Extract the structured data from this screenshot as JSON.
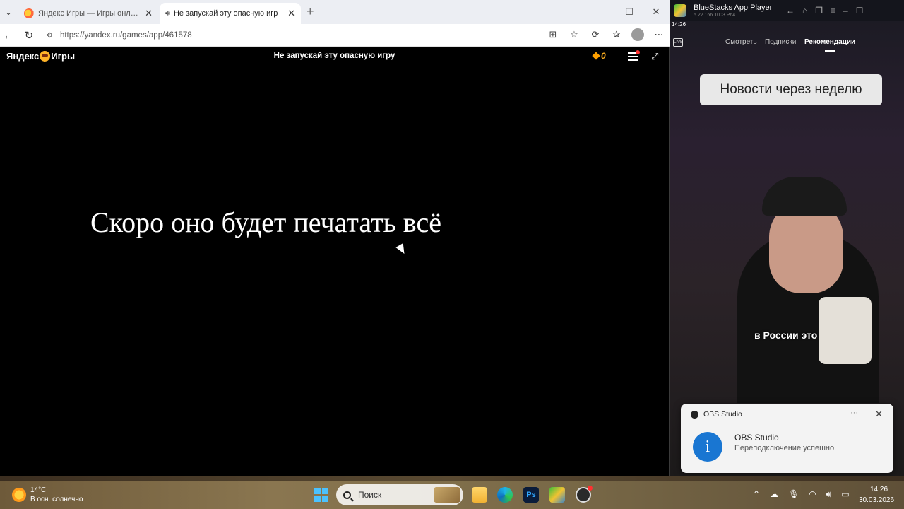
{
  "browser": {
    "tabs": [
      {
        "title": "Яндекс Игры — Игры онлайн бе",
        "active": false
      },
      {
        "title": "Не запускай эту опасную игр",
        "active": true
      }
    ],
    "url": "https://yandex.ru/games/app/461578"
  },
  "game": {
    "logo": "Яндекс",
    "logo_suffix": "Игры",
    "title": "Не запускай эту опасную игру",
    "coins": "0",
    "text": "Скоро оно будет печатать всё"
  },
  "bluestacks": {
    "app_name": "BlueStacks App Player",
    "version": "5.22.166.1003 P64",
    "status_time": "14:26",
    "tabs": [
      "Смотреть",
      "Подписки",
      "Рекомендации"
    ],
    "active_tab": "Рекомендации",
    "bubble": "Новости через неделю",
    "caption": "в России это"
  },
  "notification": {
    "app": "OBS Studio",
    "title": "OBS Studio",
    "body": "Переподключение успешно"
  },
  "taskbar": {
    "weather_temp": "14°C",
    "weather_desc": "В осн. солнечно",
    "search_placeholder": "Поиск",
    "time": "14:26",
    "date": "30.03.2026"
  },
  "colors": {
    "accent": "#1976d2",
    "coin": "#ffa000"
  }
}
